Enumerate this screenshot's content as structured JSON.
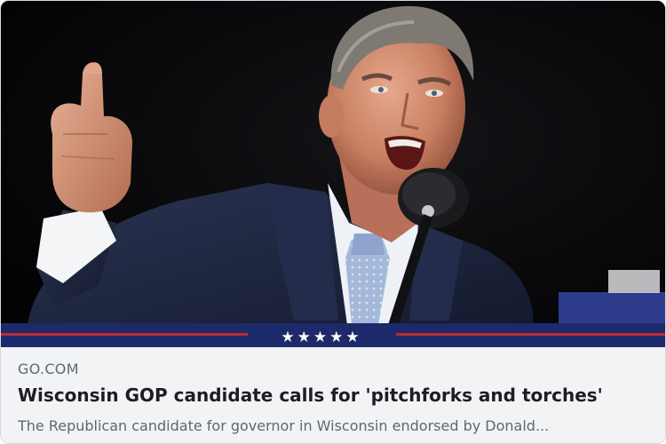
{
  "link_preview": {
    "image": {
      "description_icon": "photo-of-speaker-at-podium",
      "podium_stars": "★★★★★"
    },
    "source": "GO.COM",
    "headline": "Wisconsin GOP candidate calls for 'pitchforks and torches'",
    "description": "The Republican candidate for governor in Wisconsin endorsed by Donald..."
  },
  "colors": {
    "background": "#f2f3f5",
    "headline": "#1c1e21",
    "secondary_text": "#606770",
    "podium_navy": "#1c2a6b",
    "podium_red": "#c0292f",
    "suit": "#1e2640",
    "tie": "#9db3d6"
  }
}
